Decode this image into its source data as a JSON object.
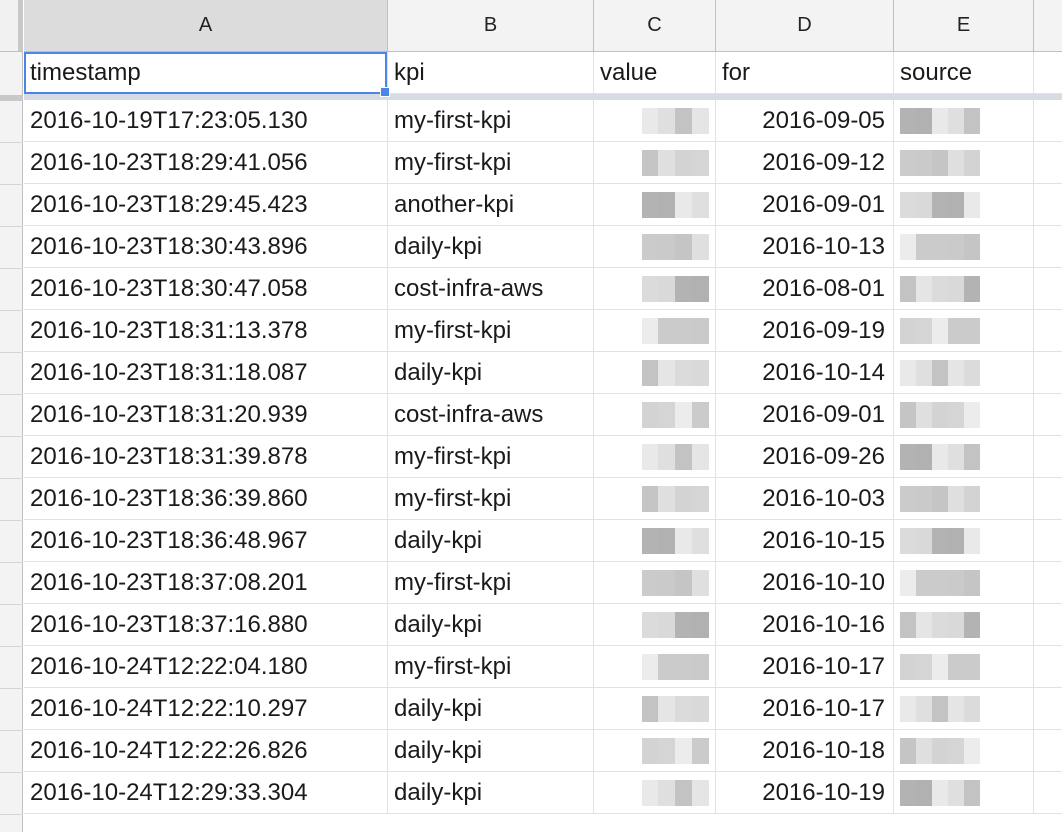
{
  "columns": [
    {
      "letter": "A",
      "active": true
    },
    {
      "letter": "B",
      "active": false
    },
    {
      "letter": "C",
      "active": false
    },
    {
      "letter": "D",
      "active": false
    },
    {
      "letter": "E",
      "active": false
    }
  ],
  "header_row": {
    "timestamp": "timestamp",
    "kpi": "kpi",
    "value": "value",
    "for": "for",
    "source": "source"
  },
  "rows": [
    {
      "timestamp": "2016-10-19T17:23:05.130",
      "kpi": "my-first-kpi",
      "for": "2016-09-05"
    },
    {
      "timestamp": "2016-10-23T18:29:41.056",
      "kpi": "my-first-kpi",
      "for": "2016-09-12"
    },
    {
      "timestamp": "2016-10-23T18:29:45.423",
      "kpi": "another-kpi",
      "for": "2016-09-01"
    },
    {
      "timestamp": "2016-10-23T18:30:43.896",
      "kpi": "daily-kpi",
      "for": "2016-10-13"
    },
    {
      "timestamp": "2016-10-23T18:30:47.058",
      "kpi": "cost-infra-aws",
      "for": "2016-08-01"
    },
    {
      "timestamp": "2016-10-23T18:31:13.378",
      "kpi": "my-first-kpi",
      "for": "2016-09-19"
    },
    {
      "timestamp": "2016-10-23T18:31:18.087",
      "kpi": "daily-kpi",
      "for": "2016-10-14"
    },
    {
      "timestamp": "2016-10-23T18:31:20.939",
      "kpi": "cost-infra-aws",
      "for": "2016-09-01"
    },
    {
      "timestamp": "2016-10-23T18:31:39.878",
      "kpi": "my-first-kpi",
      "for": "2016-09-26"
    },
    {
      "timestamp": "2016-10-23T18:36:39.860",
      "kpi": "my-first-kpi",
      "for": "2016-10-03"
    },
    {
      "timestamp": "2016-10-23T18:36:48.967",
      "kpi": "daily-kpi",
      "for": "2016-10-15"
    },
    {
      "timestamp": "2016-10-23T18:37:08.201",
      "kpi": "my-first-kpi",
      "for": "2016-10-10"
    },
    {
      "timestamp": "2016-10-23T18:37:16.880",
      "kpi": "daily-kpi",
      "for": "2016-10-16"
    },
    {
      "timestamp": "2016-10-24T12:22:04.180",
      "kpi": "my-first-kpi",
      "for": "2016-10-17"
    },
    {
      "timestamp": "2016-10-24T12:22:10.297",
      "kpi": "daily-kpi",
      "for": "2016-10-17"
    },
    {
      "timestamp": "2016-10-24T12:22:26.826",
      "kpi": "daily-kpi",
      "for": "2016-10-18"
    },
    {
      "timestamp": "2016-10-24T12:29:33.304",
      "kpi": "daily-kpi",
      "for": "2016-10-19"
    }
  ],
  "colors": {
    "selection": "#4a86e8",
    "header_bg": "#f3f3f3",
    "active_header_bg": "#dcdcdc",
    "freeze_bar": "#d6dbe4",
    "grid_line": "#e2e2e2"
  }
}
